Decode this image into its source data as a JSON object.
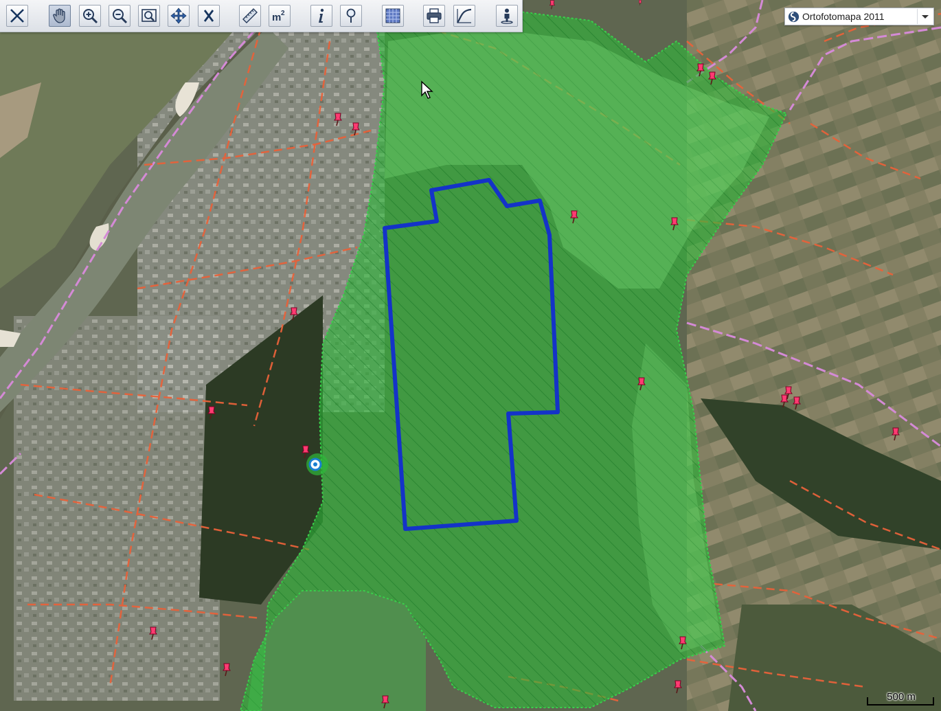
{
  "toolbar": {
    "tools": [
      {
        "id": "close-tool",
        "icon": "close-x-icon"
      },
      {
        "id": "pan-tool",
        "icon": "hand-icon"
      },
      {
        "id": "zoom-in-tool",
        "icon": "zoom-in-icon"
      },
      {
        "id": "zoom-out-tool",
        "icon": "zoom-out-icon"
      },
      {
        "id": "zoom-window-tool",
        "icon": "zoom-box-icon"
      },
      {
        "id": "full-extent-tool",
        "icon": "move-arrows-icon"
      },
      {
        "id": "clear-tool",
        "icon": "clear-x-icon"
      },
      {
        "id": "measure-distance-tool",
        "icon": "ruler-icon"
      },
      {
        "id": "measure-area-tool",
        "icon": "area-m2-icon"
      },
      {
        "id": "info-tool",
        "icon": "info-icon"
      },
      {
        "id": "identify-tool",
        "icon": "pin-search-icon"
      },
      {
        "id": "layers-tool",
        "icon": "grid-layers-icon"
      },
      {
        "id": "print-tool",
        "icon": "printer-icon"
      },
      {
        "id": "profile-tool",
        "icon": "profile-curve-icon"
      },
      {
        "id": "street-view-tool",
        "icon": "person-icon"
      }
    ],
    "area_label": "m",
    "area_sup": "2"
  },
  "basemap": {
    "selected": "Ortofotomapa 2011",
    "icon": "swirl-logo-icon"
  },
  "scalebar": {
    "label": "500 m"
  },
  "colors": {
    "protected_area_fill": "#2fb83a",
    "protected_area_border": "#38c54a",
    "selected_parcel_outline": "#1433c8",
    "boundary_dashes": "#e8623a",
    "admin_boundary": "#d48ad6",
    "marker": "#ff3b72"
  },
  "markers": {
    "icon": "map-pin-icon",
    "count": 23
  }
}
